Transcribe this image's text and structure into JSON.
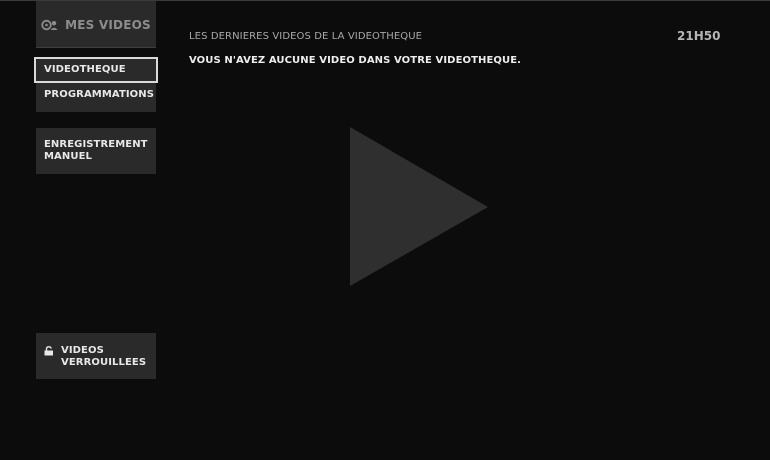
{
  "sidebar": {
    "header": {
      "title": "MES VIDEOS",
      "icon": "videos-library-icon"
    },
    "items": [
      {
        "label": "VIDEOTHEQUE",
        "selected": true
      },
      {
        "label": "PROGRAMMATIONS",
        "selected": false
      }
    ],
    "manual_recording": {
      "line1": "ENREGISTREMENT",
      "line2": "MANUEL"
    },
    "locked_videos": {
      "line1": "VIDEOS",
      "line2": "VERROUILLEES",
      "icon": "padlock-icon"
    }
  },
  "content": {
    "heading": "LES DERNIERES VIDEOS DE LA VIDEOTHEQUE",
    "empty_message": "VOUS N'AVEZ AUCUNE VIDEO DANS VOTRE VIDEOTHEQUE.",
    "placeholder_icon": "play-icon"
  },
  "clock": "21H50",
  "colors": {
    "background": "#0c0c0c",
    "panel": "#2a2a2a",
    "selection_border": "#d9d9d9",
    "play_placeholder": "#2f2f2f"
  }
}
